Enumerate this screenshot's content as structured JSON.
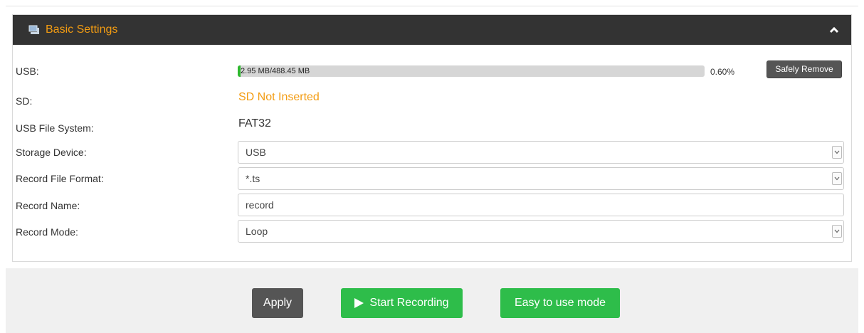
{
  "panel": {
    "title": "Basic Settings",
    "accent_color": "#f39c12",
    "header_icon": "monitor-icon",
    "collapse_icon": "chevron-up-icon"
  },
  "usb": {
    "label": "USB:",
    "usage_text": "2.95 MB/488.45 MB",
    "percent_text": "0.60%",
    "percent_value": 0.006,
    "safely_remove_label": "Safely Remove"
  },
  "sd": {
    "label": "SD:",
    "status": "SD Not Inserted"
  },
  "usb_fs": {
    "label": "USB File System:",
    "value": "FAT32"
  },
  "storage_device": {
    "label": "Storage Device:",
    "value": "USB"
  },
  "record_file_format": {
    "label": "Record File Format:",
    "value": "*.ts"
  },
  "record_name": {
    "label": "Record Name:",
    "value": "record"
  },
  "record_mode": {
    "label": "Record Mode:",
    "value": "Loop"
  },
  "footer": {
    "apply_label": "Apply",
    "start_recording_label": "Start Recording",
    "easy_mode_label": "Easy to use mode",
    "start_icon": "play-icon"
  }
}
